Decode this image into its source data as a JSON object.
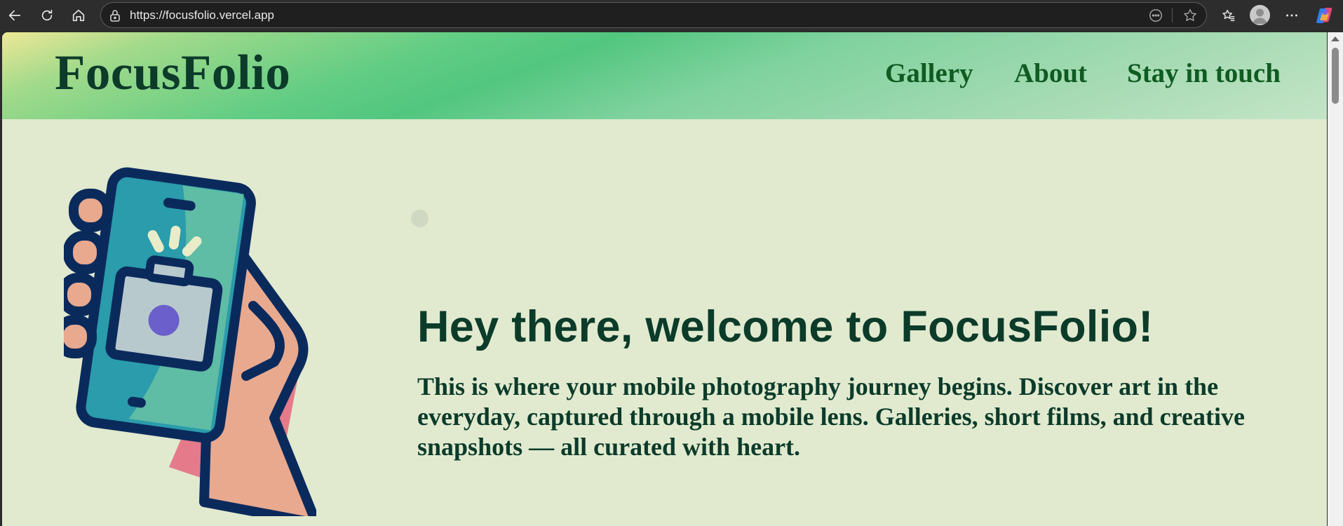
{
  "browser": {
    "url": "https://focusfolio.vercel.app",
    "icons": {
      "back": "back-arrow-icon",
      "refresh": "refresh-icon",
      "home": "home-icon",
      "lock": "lock-icon",
      "reader": "reader-mode-icon",
      "favorite": "star-icon",
      "favorites_bar": "favorites-icon",
      "profile": "profile-avatar",
      "menu": "more-icon",
      "copilot": "copilot-icon"
    }
  },
  "site": {
    "logo": "FocusFolio",
    "nav": {
      "gallery": "Gallery",
      "about": "About",
      "contact": "Stay in touch"
    },
    "hero": {
      "title": "Hey there, welcome to FocusFolio!",
      "text": "This is where your mobile photography journey begins. Discover art in the everyday, captured through a mobile lens. Galleries, short films, and creative snapshots — all curated with heart."
    },
    "colors": {
      "page_bg": "#e1eacf",
      "heading": "#0c3b2a",
      "nav": "#0f5b22",
      "header_gradient_start": "#eee896",
      "header_gradient_mid": "#52c67f",
      "header_gradient_end": "#c4e4c7"
    }
  }
}
